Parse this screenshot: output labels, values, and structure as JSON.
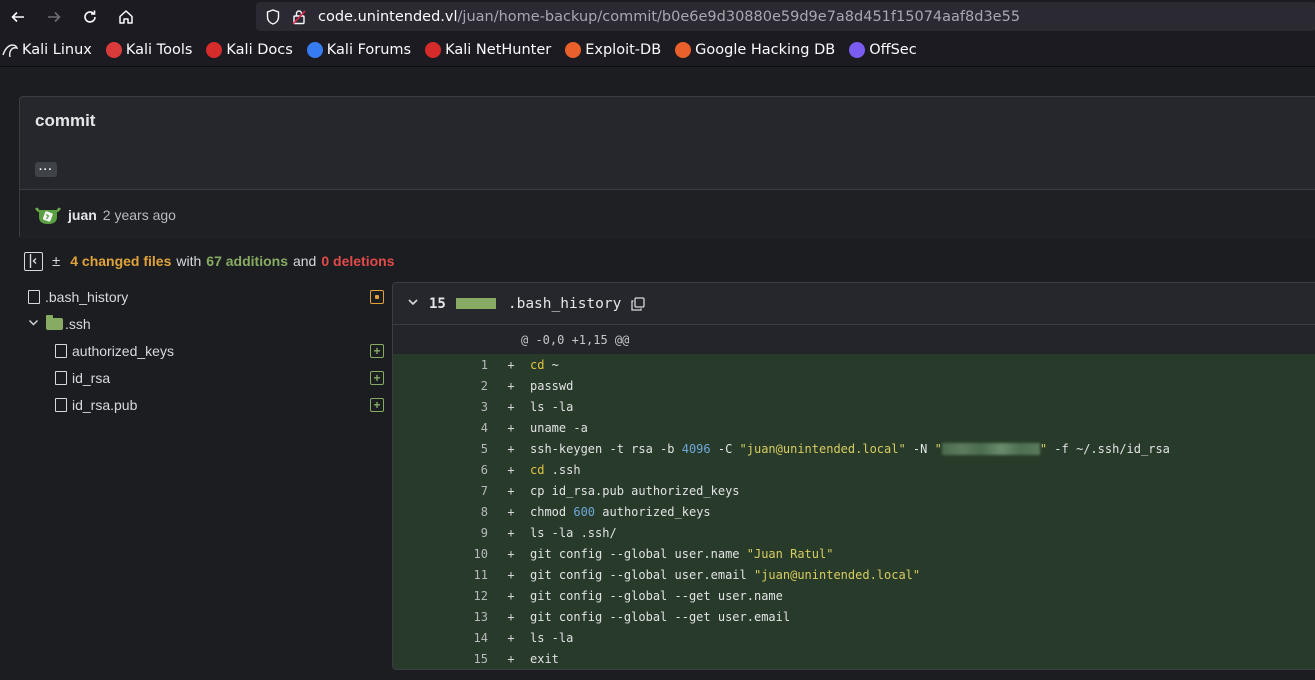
{
  "browser": {
    "url_host": "code.unintended.vl",
    "url_path": "/juan/home-backup/commit/b0e6e9d30880e59d9e7a8d451f15074aaf8d3e55"
  },
  "bookmarks": [
    {
      "label": "Kali Linux",
      "icon": "kali-dragon-icon",
      "color": "#367bf0"
    },
    {
      "label": "Kali Tools",
      "icon": "kali-tools-icon",
      "color": "#d93b3b"
    },
    {
      "label": "Kali Docs",
      "icon": "kali-docs-icon",
      "color": "#d62b2b"
    },
    {
      "label": "Kali Forums",
      "icon": "kali-forums-icon",
      "color": "#367bf0"
    },
    {
      "label": "Kali NetHunter",
      "icon": "nethunter-icon",
      "color": "#d62b2b"
    },
    {
      "label": "Exploit-DB",
      "icon": "exploit-db-icon",
      "color": "#e8602a"
    },
    {
      "label": "Google Hacking DB",
      "icon": "ghdb-icon",
      "color": "#e8602a"
    },
    {
      "label": "OffSec",
      "icon": "offsec-icon",
      "color": "#7a5cf0"
    }
  ],
  "commit": {
    "title": "commit",
    "ellipsis": "···",
    "author": "juan",
    "time": "2 years ago"
  },
  "stats": {
    "plusminus": "±",
    "changed": "4 changed files",
    "with": "with",
    "additions": "67 additions",
    "and": "and",
    "deletions": "0 deletions"
  },
  "tree": {
    "bash_history": ".bash_history",
    "ssh": ".ssh",
    "authorized_keys": "authorized_keys",
    "id_rsa": "id_rsa",
    "id_rsa_pub": "id_rsa.pub"
  },
  "diff": {
    "count": "15",
    "filename": ".bash_history",
    "hunk": "@ -0,0 +1,15 @@",
    "lines": [
      {
        "n": "1",
        "parts": [
          [
            "kw",
            "cd"
          ],
          [
            "",
            " ~"
          ]
        ]
      },
      {
        "n": "2",
        "parts": [
          [
            "",
            "passwd"
          ]
        ]
      },
      {
        "n": "3",
        "parts": [
          [
            "",
            "ls -la"
          ]
        ]
      },
      {
        "n": "4",
        "parts": [
          [
            "",
            "uname -a"
          ]
        ]
      },
      {
        "n": "5",
        "parts": [
          [
            "",
            "ssh-keygen -t rsa -b "
          ],
          [
            "nm",
            "4096"
          ],
          [
            "",
            " -C "
          ],
          [
            "st",
            "\"juan@unintended.local\""
          ],
          [
            "",
            " -N "
          ],
          [
            "st",
            "\""
          ],
          [
            "blur",
            ""
          ],
          [
            "st",
            "\""
          ],
          [
            "",
            " -f ~/.ssh/id_rsa"
          ]
        ]
      },
      {
        "n": "6",
        "parts": [
          [
            "kw",
            "cd"
          ],
          [
            "",
            " .ssh"
          ]
        ]
      },
      {
        "n": "7",
        "parts": [
          [
            "",
            "cp id_rsa.pub authorized_keys"
          ]
        ]
      },
      {
        "n": "8",
        "parts": [
          [
            "",
            "chmod "
          ],
          [
            "nm",
            "600"
          ],
          [
            "",
            " authorized_keys"
          ]
        ]
      },
      {
        "n": "9",
        "parts": [
          [
            "",
            "ls -la .ssh/"
          ]
        ]
      },
      {
        "n": "10",
        "parts": [
          [
            "",
            "git config --global user.name "
          ],
          [
            "st",
            "\"Juan Ratul\""
          ]
        ]
      },
      {
        "n": "11",
        "parts": [
          [
            "",
            "git config --global user.email "
          ],
          [
            "st",
            "\"juan@unintended.local\""
          ]
        ]
      },
      {
        "n": "12",
        "parts": [
          [
            "",
            "git config --global --get user.name"
          ]
        ]
      },
      {
        "n": "13",
        "parts": [
          [
            "",
            "git config --global --get user.email"
          ]
        ]
      },
      {
        "n": "14",
        "parts": [
          [
            "",
            "ls -la"
          ]
        ]
      },
      {
        "n": "15",
        "parts": [
          [
            "",
            "exit"
          ]
        ]
      }
    ]
  }
}
